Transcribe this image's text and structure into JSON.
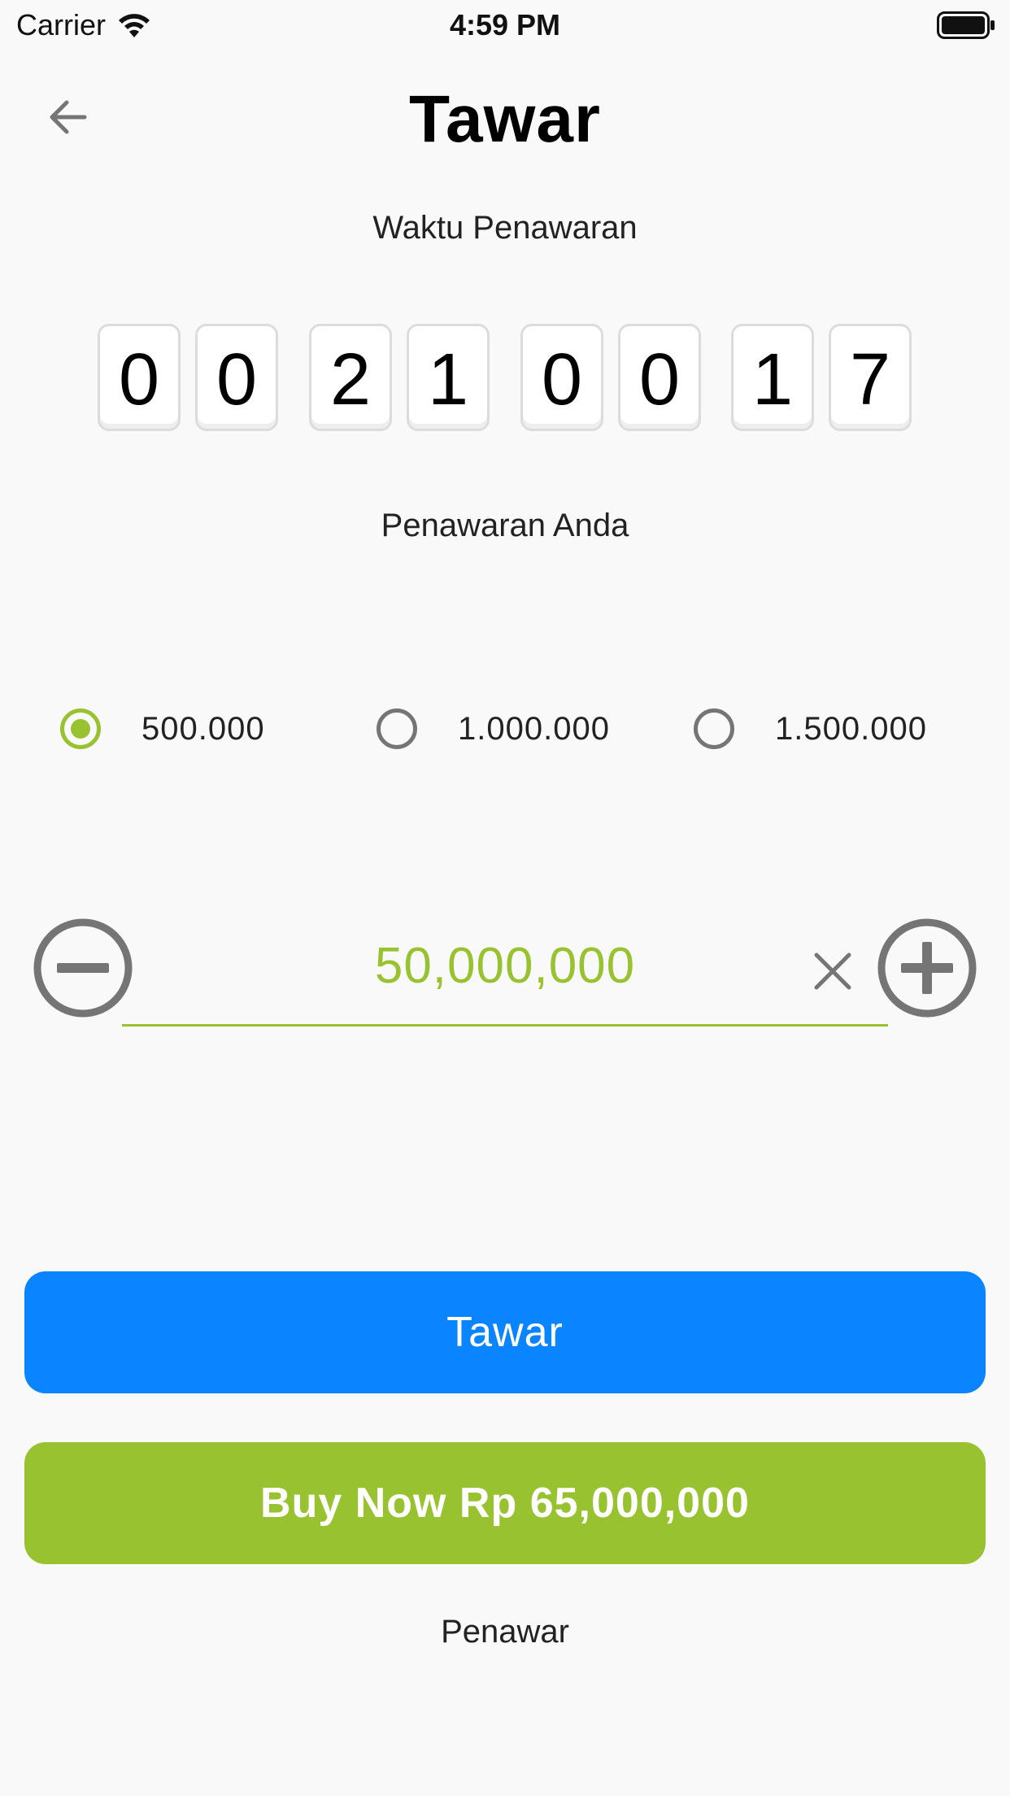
{
  "status_bar": {
    "carrier": "Carrier",
    "time": "4:59 PM",
    "battery_icon": "battery-full-icon",
    "wifi_icon": "wifi-icon"
  },
  "header": {
    "title": "Tawar",
    "back_icon": "arrow-left-icon"
  },
  "countdown": {
    "label": "Waktu Penawaran",
    "digits": [
      "0",
      "0",
      "2",
      "1",
      "0",
      "0",
      "1",
      "7"
    ]
  },
  "offer": {
    "label": "Penawaran Anda",
    "options": [
      {
        "label": "500.000",
        "selected": true
      },
      {
        "label": "1.000.000",
        "selected": false
      },
      {
        "label": "1.500.000",
        "selected": false
      }
    ],
    "value": "50,000,000",
    "decrement_icon": "minus-circle-icon",
    "increment_icon": "plus-circle-icon",
    "clear_icon": "close-icon"
  },
  "actions": {
    "bid_label": "Tawar",
    "buy_now_label": "Buy Now Rp 65,000,000"
  },
  "footer": {
    "bidders_label": "Penawar"
  },
  "colors": {
    "accent_green": "#98c22f",
    "primary_blue": "#0a84ff",
    "icon_gray": "#757575",
    "background": "#f9f9f9"
  }
}
